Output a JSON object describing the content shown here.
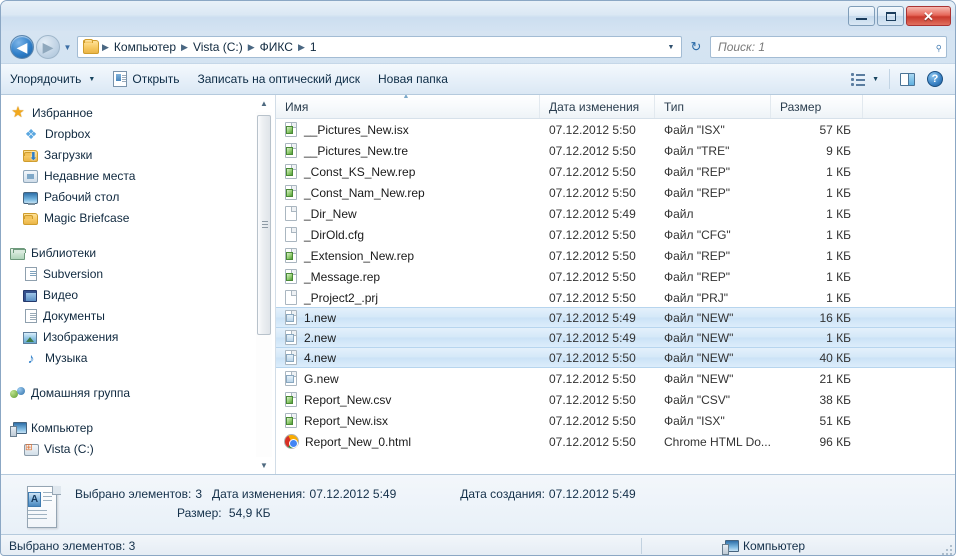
{
  "window": {
    "controls": {
      "minimize": "Свернуть",
      "maximize": "Развернуть",
      "close": "Закрыть"
    }
  },
  "address": {
    "back_tooltip": "Назад",
    "forward_tooltip": "Вперёд",
    "history_tooltip": "Последние страницы",
    "breadcrumbs": [
      "Компьютер",
      "Vista (C:)",
      "ФИКС",
      "1"
    ],
    "separator": "▶",
    "refresh_glyph": "↻"
  },
  "search": {
    "placeholder": "Поиск: 1",
    "value": "",
    "icon": "search-icon"
  },
  "toolbar": {
    "organize": "Упорядочить",
    "open": "Открыть",
    "burn": "Записать на оптический диск",
    "new_folder": "Новая папка",
    "views_tooltip": "Изменить представление",
    "preview_tooltip": "Область предпросмотра",
    "help_tooltip": "Справка",
    "help_glyph": "?"
  },
  "navpane": {
    "groups": [
      {
        "header": {
          "label": "Избранное",
          "icon": "star-icon"
        },
        "items": [
          {
            "label": "Dropbox",
            "icon": "dropbox-icon"
          },
          {
            "label": "Загрузки",
            "icon": "downloads-folder-icon"
          },
          {
            "label": "Недавние места",
            "icon": "recent-places-icon"
          },
          {
            "label": "Рабочий стол",
            "icon": "desktop-icon"
          },
          {
            "label": "Magic Briefcase",
            "icon": "folder-icon"
          }
        ]
      },
      {
        "header": {
          "label": "Библиотеки",
          "icon": "libraries-icon"
        },
        "items": [
          {
            "label": "Subversion",
            "icon": "document-icon"
          },
          {
            "label": "Видео",
            "icon": "video-icon"
          },
          {
            "label": "Документы",
            "icon": "document-icon"
          },
          {
            "label": "Изображения",
            "icon": "pictures-icon"
          },
          {
            "label": "Музыка",
            "icon": "music-icon"
          }
        ]
      },
      {
        "header": {
          "label": "Домашняя группа",
          "icon": "homegroup-icon"
        },
        "items": []
      },
      {
        "header": {
          "label": "Компьютер",
          "icon": "computer-icon"
        },
        "items": [
          {
            "label": "Vista (C:)",
            "icon": "windows-drive-icon"
          }
        ]
      }
    ]
  },
  "filelist": {
    "columns": [
      {
        "key": "name",
        "label": "Имя",
        "sorted": true
      },
      {
        "key": "date",
        "label": "Дата изменения",
        "sorted": false
      },
      {
        "key": "type",
        "label": "Тип",
        "sorted": false
      },
      {
        "key": "size",
        "label": "Размер",
        "sorted": false
      }
    ],
    "rows": [
      {
        "name": "__Pictures_New.isx",
        "date": "07.12.2012 5:50",
        "type": "Файл \"ISX\"",
        "size": "57 КБ",
        "icon": "rep-file-icon",
        "selected": false
      },
      {
        "name": "__Pictures_New.tre",
        "date": "07.12.2012 5:50",
        "type": "Файл \"TRE\"",
        "size": "9 КБ",
        "icon": "rep-file-icon",
        "selected": false
      },
      {
        "name": "_Const_KS_New.rep",
        "date": "07.12.2012 5:50",
        "type": "Файл \"REP\"",
        "size": "1 КБ",
        "icon": "rep-file-icon",
        "selected": false
      },
      {
        "name": "_Const_Nam_New.rep",
        "date": "07.12.2012 5:50",
        "type": "Файл \"REP\"",
        "size": "1 КБ",
        "icon": "rep-file-icon",
        "selected": false
      },
      {
        "name": "_Dir_New",
        "date": "07.12.2012 5:49",
        "type": "Файл",
        "size": "1 КБ",
        "icon": "blank-file-icon",
        "selected": false
      },
      {
        "name": "_DirOld.cfg",
        "date": "07.12.2012 5:50",
        "type": "Файл \"CFG\"",
        "size": "1 КБ",
        "icon": "blank-file-icon",
        "selected": false
      },
      {
        "name": "_Extension_New.rep",
        "date": "07.12.2012 5:50",
        "type": "Файл \"REP\"",
        "size": "1 КБ",
        "icon": "rep-file-icon",
        "selected": false
      },
      {
        "name": "_Message.rep",
        "date": "07.12.2012 5:50",
        "type": "Файл \"REP\"",
        "size": "1 КБ",
        "icon": "rep-file-icon",
        "selected": false
      },
      {
        "name": "_Project2_.prj",
        "date": "07.12.2012 5:50",
        "type": "Файл \"PRJ\"",
        "size": "1 КБ",
        "icon": "blank-file-icon",
        "selected": false
      },
      {
        "name": "1.new",
        "date": "07.12.2012 5:49",
        "type": "Файл \"NEW\"",
        "size": "16 КБ",
        "icon": "new-file-icon",
        "selected": true
      },
      {
        "name": "2.new",
        "date": "07.12.2012 5:49",
        "type": "Файл \"NEW\"",
        "size": "1 КБ",
        "icon": "new-file-icon",
        "selected": true
      },
      {
        "name": "4.new",
        "date": "07.12.2012 5:50",
        "type": "Файл \"NEW\"",
        "size": "40 КБ",
        "icon": "new-file-icon",
        "selected": true
      },
      {
        "name": "G.new",
        "date": "07.12.2012 5:50",
        "type": "Файл \"NEW\"",
        "size": "21 КБ",
        "icon": "new-file-icon",
        "selected": false
      },
      {
        "name": "Report_New.csv",
        "date": "07.12.2012 5:50",
        "type": "Файл \"CSV\"",
        "size": "38 КБ",
        "icon": "rep-file-icon",
        "selected": false
      },
      {
        "name": "Report_New.isx",
        "date": "07.12.2012 5:50",
        "type": "Файл \"ISX\"",
        "size": "51 КБ",
        "icon": "rep-file-icon",
        "selected": false
      },
      {
        "name": "Report_New_0.html",
        "date": "07.12.2012 5:50",
        "type": "Chrome HTML Do...",
        "size": "96 КБ",
        "icon": "chrome-icon",
        "selected": false
      }
    ]
  },
  "details": {
    "selected_label": "Выбрано элементов:",
    "selected_value": "3",
    "modified_label": "Дата изменения:",
    "modified_value": "07.12.2012 5:49",
    "created_label": "Дата создания:",
    "created_value": "07.12.2012 5:49",
    "size_label": "Размер:",
    "size_value": "54,9 КБ",
    "icon_glyph": "A"
  },
  "statusbar": {
    "left": "Выбрано элементов: 3",
    "right": "Компьютер",
    "right_icon": "computer-icon"
  },
  "colors": {
    "accent": "#2f7fc9",
    "selection_border": "#b7d5ee",
    "selection_fill": "#d4e8f8",
    "chrome_bg": "#cddff0"
  }
}
